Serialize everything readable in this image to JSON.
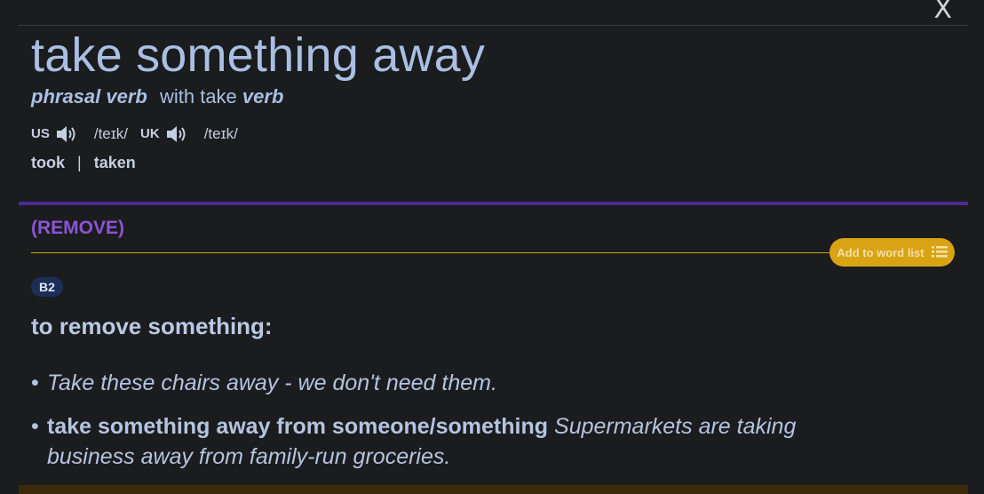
{
  "entry": {
    "headword": "take something away",
    "pos": "phrasal verb",
    "with_text": "with take",
    "with_pos": "verb",
    "close_label": "X"
  },
  "pronunciation": {
    "us_label": "US",
    "us_ipa": "/teɪk/",
    "uk_label": "UK",
    "uk_ipa": "/teɪk/",
    "icon": "speaker-icon"
  },
  "forms": {
    "past": "took",
    "separator": "|",
    "past_participle": "taken"
  },
  "sense": {
    "guideword": "(REMOVE)",
    "add_to_word_list": "Add to word list",
    "level": "B2",
    "definition": "to remove something:",
    "examples": [
      {
        "bullet": "•",
        "phrase": "",
        "text": "Take these chairs away - we don't need them."
      },
      {
        "bullet": "•",
        "phrase": "take something away from someone/something",
        "text": "Supermarkets are taking business away from family-run groceries."
      }
    ]
  },
  "colors": {
    "background": "#1b1c1e",
    "headword": "#a9bfe3",
    "guideword": "#8b55d6",
    "purple_rule": "#4c2b91",
    "gold_accent": "#d9a414",
    "level_badge": "#1c2d57"
  }
}
